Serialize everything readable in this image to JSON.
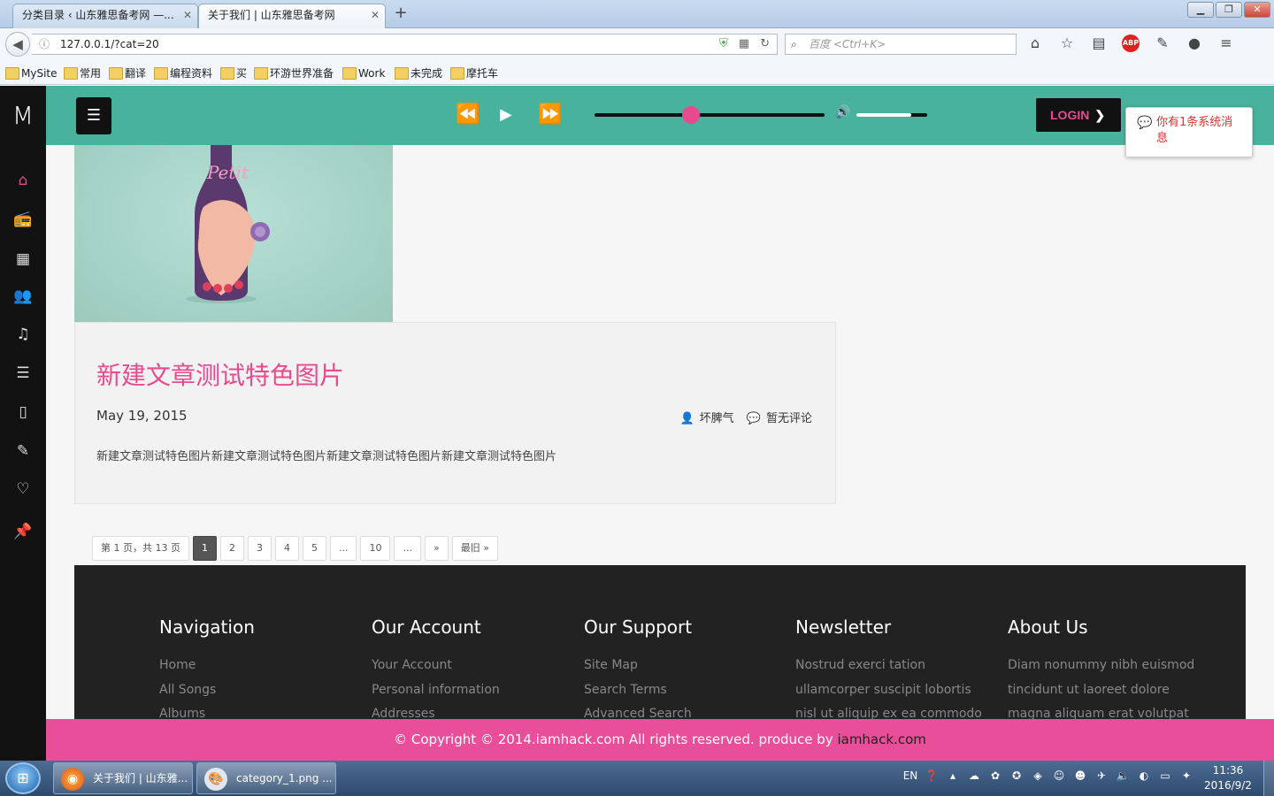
{
  "browser": {
    "tabs": [
      {
        "label": "分类目录 ‹ 山东雅思备考网 —..."
      },
      {
        "label": "关于我们 | 山东雅思备考网"
      }
    ],
    "url": "127.0.0.1/?cat=20",
    "search_placeholder": "百度 <Ctrl+K>",
    "bookmarks": [
      "MySite",
      "常用",
      "翻译",
      "编程资料",
      "买",
      "环游世界准备",
      "Work",
      "未完成",
      "摩托车"
    ]
  },
  "site": {
    "logo": "M",
    "login_label": "LOGIN",
    "notice": "你有1条系统消息",
    "player": {
      "progress": 0.42,
      "volume": 0.78
    },
    "accent": "#e84a8f",
    "header_color": "#48b29c"
  },
  "post": {
    "title": "新建文章测试特色图片",
    "date": "May 19, 2015",
    "author": "坏脾气",
    "comments": "暂无评论",
    "excerpt": "新建文章测试特色图片新建文章测试特色图片新建文章测试特色图片新建文章测试特色图片",
    "image_text": "Petit"
  },
  "pagination": {
    "summary": "第 1 页，共 13 页",
    "pages": [
      "1",
      "2",
      "3",
      "4",
      "5",
      "...",
      "10",
      "...",
      "»",
      "最旧 »"
    ]
  },
  "footer": {
    "columns": [
      {
        "title": "Navigation",
        "items": [
          "Home",
          "All Songs",
          "Albums"
        ]
      },
      {
        "title": "Our Account",
        "items": [
          "Your Account",
          "Personal information",
          "Addresses"
        ]
      },
      {
        "title": "Our Support",
        "items": [
          "Site Map",
          "Search Terms",
          "Advanced Search"
        ]
      },
      {
        "title": "Newsletter",
        "items": [
          "Nostrud exerci tation",
          "ullamcorper suscipit lobortis",
          "nisl ut aliquip ex ea commodo"
        ]
      },
      {
        "title": "About Us",
        "items": [
          "Diam nonummy nibh euismod",
          "tincidunt ut laoreet dolore",
          "magna aliquam erat volutpat"
        ]
      }
    ],
    "copyright_text": "© Copyright © 2014.iamhack.com All rights reserved. produce by ",
    "copyright_link": "iamhack.com"
  },
  "taskbar": {
    "tasks": [
      {
        "label": "关于我们 | 山东雅..."
      },
      {
        "label": "category_1.png ..."
      }
    ],
    "tray_lang": "EN",
    "time": "11:36",
    "date": "2016/9/2"
  }
}
